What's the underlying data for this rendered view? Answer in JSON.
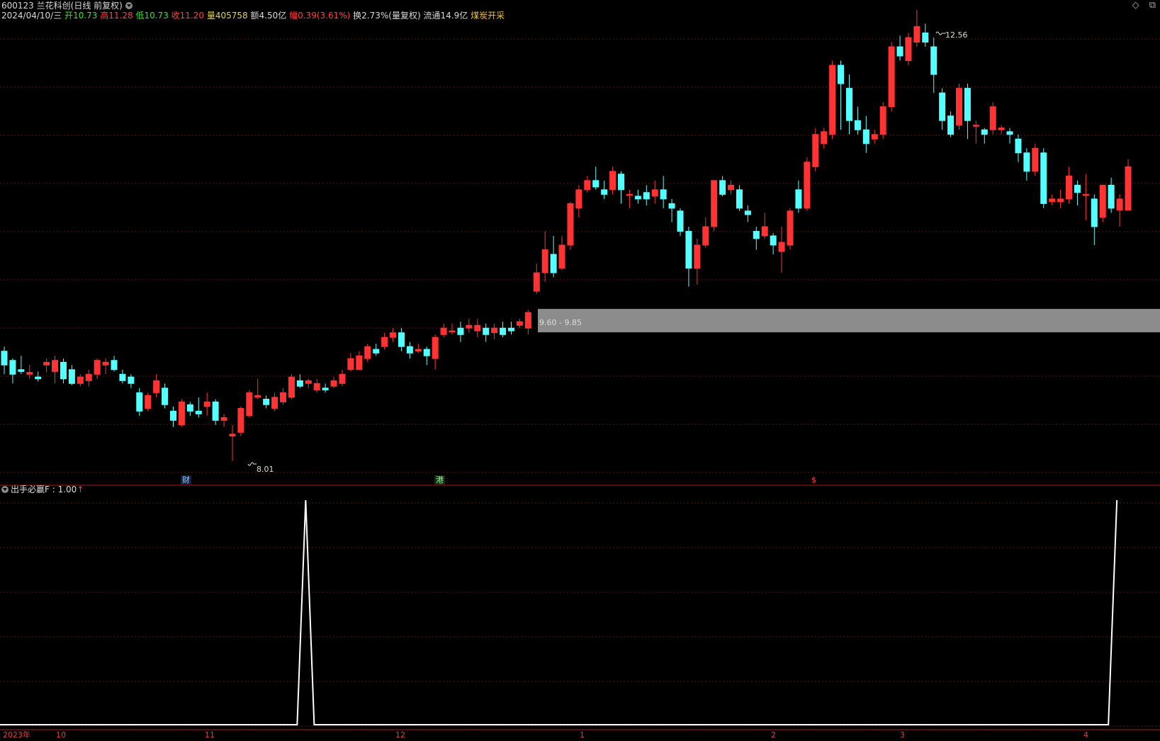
{
  "header": {
    "code": "600123",
    "name": "兰花科创",
    "mode": "(日线 前复权)",
    "date": "2024/04/10/三",
    "open_label": "开",
    "open": "10.73",
    "high_label": "高",
    "high": "11.28",
    "low_label": "低",
    "low": "10.73",
    "close_label": "收",
    "close": "11.20",
    "vol_label": "量",
    "vol": "405758",
    "amt_label": "额",
    "amt": "4.50亿",
    "chg_label": "幅",
    "chg": "0.39(3.61%)",
    "turn_label": "换",
    "turn": "2.73%(量复权)",
    "float_label": "流通",
    "float": "14.9亿",
    "concept": "煤炭开采"
  },
  "window_icons": [
    "diamond-icon",
    "restore-icon"
  ],
  "annotations": {
    "high_marker": "12.56",
    "low_marker": "8.01",
    "zone_label": "9.60 - 9.85"
  },
  "badges": {
    "cai": "财",
    "gang": "港",
    "dollar": "$"
  },
  "indicator": {
    "title": "出手必赢F",
    "value": ": 1.00",
    "arrow": "↑"
  },
  "x_labels": [
    "2023年",
    "10",
    "11",
    "12",
    "1",
    "2",
    "3",
    "4"
  ],
  "colors": {
    "up": "#ff3333",
    "down": "#54ffff",
    "grid": "#6a1010",
    "zone": "#8c8c8c",
    "line": "#ffffff"
  },
  "chart_data": {
    "type": "candlestick",
    "ylim": [
      7.9,
      12.7
    ],
    "candles": [
      [
        9.2,
        9.05,
        9.25,
        8.95
      ],
      [
        9.1,
        8.95,
        9.12,
        8.85
      ],
      [
        9.0,
        8.98,
        9.15,
        8.95
      ],
      [
        8.95,
        8.97,
        9.05,
        8.9
      ],
      [
        8.92,
        8.9,
        8.98,
        8.87
      ],
      [
        9.05,
        9.08,
        9.12,
        8.97
      ],
      [
        8.98,
        9.1,
        9.15,
        8.85
      ],
      [
        9.08,
        8.9,
        9.12,
        8.85
      ],
      [
        9.0,
        8.85,
        9.05,
        8.83
      ],
      [
        8.85,
        8.92,
        8.95,
        8.82
      ],
      [
        8.88,
        8.95,
        9.0,
        8.82
      ],
      [
        8.95,
        9.1,
        9.12,
        8.9
      ],
      [
        9.05,
        9.08,
        9.12,
        8.95
      ],
      [
        9.1,
        9.0,
        9.15,
        8.98
      ],
      [
        8.95,
        8.88,
        9.0,
        8.85
      ],
      [
        8.92,
        8.85,
        8.95,
        8.8
      ],
      [
        8.75,
        8.55,
        8.8,
        8.5
      ],
      [
        8.58,
        8.72,
        8.75,
        8.55
      ],
      [
        8.75,
        8.88,
        8.95,
        8.7
      ],
      [
        8.8,
        8.62,
        8.85,
        8.58
      ],
      [
        8.55,
        8.45,
        8.6,
        8.38
      ],
      [
        8.4,
        8.65,
        8.68,
        8.38
      ],
      [
        8.62,
        8.55,
        8.65,
        8.5
      ],
      [
        8.55,
        8.52,
        8.7,
        8.48
      ],
      [
        8.6,
        8.65,
        8.75,
        8.5
      ],
      [
        8.65,
        8.45,
        8.68,
        8.4
      ],
      [
        8.45,
        8.48,
        8.52,
        8.38
      ],
      [
        8.28,
        8.3,
        8.4,
        8.01
      ],
      [
        8.32,
        8.58,
        8.6,
        8.28
      ],
      [
        8.5,
        8.75,
        8.78,
        8.48
      ],
      [
        8.7,
        8.72,
        8.9,
        8.68
      ],
      [
        8.68,
        8.62,
        8.72,
        8.58
      ],
      [
        8.58,
        8.7,
        8.75,
        8.55
      ],
      [
        8.65,
        8.75,
        8.8,
        8.62
      ],
      [
        8.7,
        8.92,
        8.95,
        8.68
      ],
      [
        8.88,
        8.82,
        8.95,
        8.8
      ],
      [
        8.85,
        8.88,
        8.9,
        8.8
      ],
      [
        8.78,
        8.85,
        8.9,
        8.75
      ],
      [
        8.8,
        8.78,
        8.85,
        8.75
      ],
      [
        8.82,
        8.88,
        8.92,
        8.8
      ],
      [
        8.85,
        8.95,
        9.0,
        8.82
      ],
      [
        9.0,
        9.12,
        9.18,
        8.98
      ],
      [
        9.0,
        9.15,
        9.2,
        9.0
      ],
      [
        9.12,
        9.25,
        9.28,
        9.08
      ],
      [
        9.22,
        9.18,
        9.28,
        9.15
      ],
      [
        9.25,
        9.35,
        9.4,
        9.22
      ],
      [
        9.35,
        9.4,
        9.45,
        9.3
      ],
      [
        9.4,
        9.25,
        9.45,
        9.2
      ],
      [
        9.25,
        9.18,
        9.3,
        9.12
      ],
      [
        9.2,
        9.22,
        9.28,
        9.18
      ],
      [
        9.22,
        9.15,
        9.25,
        9.05
      ],
      [
        9.12,
        9.35,
        9.38,
        9.0
      ],
      [
        9.38,
        9.45,
        9.5,
        9.35
      ],
      [
        9.42,
        9.42,
        9.5,
        9.38
      ],
      [
        9.45,
        9.38,
        9.52,
        9.3
      ],
      [
        9.45,
        9.48,
        9.55,
        9.4
      ],
      [
        9.42,
        9.48,
        9.55,
        9.35
      ],
      [
        9.45,
        9.38,
        9.5,
        9.3
      ],
      [
        9.4,
        9.45,
        9.5,
        9.33
      ],
      [
        9.45,
        9.38,
        9.52,
        9.35
      ],
      [
        9.45,
        9.42,
        9.52,
        9.38
      ],
      [
        9.48,
        9.52,
        9.55,
        9.45
      ],
      [
        9.45,
        9.62,
        9.65,
        9.38
      ],
      [
        9.85,
        10.05,
        10.15,
        9.82
      ],
      [
        10.05,
        10.3,
        10.5,
        9.95
      ],
      [
        10.25,
        10.05,
        10.45,
        10.0
      ],
      [
        10.1,
        10.35,
        10.45,
        10.08
      ],
      [
        10.35,
        10.8,
        10.82,
        10.3
      ],
      [
        10.75,
        10.95,
        11.0,
        10.65
      ],
      [
        10.95,
        11.05,
        11.1,
        10.92
      ],
      [
        11.05,
        10.98,
        11.2,
        10.95
      ],
      [
        10.95,
        10.9,
        11.05,
        10.85
      ],
      [
        10.95,
        11.15,
        11.2,
        10.9
      ],
      [
        11.12,
        10.95,
        11.15,
        10.8
      ],
      [
        10.9,
        10.9,
        10.95,
        10.75
      ],
      [
        10.88,
        10.85,
        10.95,
        10.8
      ],
      [
        10.92,
        10.85,
        11.0,
        10.78
      ],
      [
        10.88,
        10.95,
        11.05,
        10.8
      ],
      [
        10.95,
        10.85,
        11.1,
        10.75
      ],
      [
        10.8,
        10.75,
        10.85,
        10.6
      ],
      [
        10.72,
        10.5,
        10.75,
        10.45
      ],
      [
        10.5,
        10.1,
        10.55,
        9.9
      ],
      [
        10.1,
        10.35,
        10.42,
        9.92
      ],
      [
        10.35,
        10.55,
        10.65,
        10.32
      ],
      [
        10.55,
        11.05,
        11.05,
        10.5
      ],
      [
        11.05,
        10.9,
        11.1,
        10.88
      ],
      [
        10.95,
        11.0,
        11.05,
        10.9
      ],
      [
        10.95,
        10.75,
        11.0,
        10.72
      ],
      [
        10.72,
        10.68,
        10.78,
        10.6
      ],
      [
        10.5,
        10.42,
        10.55,
        10.3
      ],
      [
        10.45,
        10.55,
        10.7,
        10.42
      ],
      [
        10.45,
        10.35,
        10.48,
        10.25
      ],
      [
        10.28,
        10.38,
        10.55,
        10.05
      ],
      [
        10.35,
        10.72,
        10.75,
        10.3
      ],
      [
        10.95,
        10.75,
        11.05,
        10.7
      ],
      [
        10.75,
        11.25,
        11.3,
        10.72
      ],
      [
        11.2,
        11.55,
        11.62,
        11.15
      ],
      [
        11.45,
        11.58,
        11.62,
        11.4
      ],
      [
        11.55,
        12.3,
        12.35,
        11.5
      ],
      [
        12.3,
        12.1,
        12.35,
        11.6
      ],
      [
        12.05,
        11.7,
        12.2,
        11.55
      ],
      [
        11.7,
        11.6,
        11.85,
        11.55
      ],
      [
        11.6,
        11.45,
        11.75,
        11.35
      ],
      [
        11.5,
        11.55,
        11.6,
        11.45
      ],
      [
        11.55,
        11.85,
        11.9,
        11.5
      ],
      [
        11.85,
        12.5,
        12.55,
        11.8
      ],
      [
        12.5,
        12.4,
        12.62,
        12.35
      ],
      [
        12.35,
        12.6,
        12.65,
        12.3
      ],
      [
        12.55,
        12.72,
        12.9,
        12.5
      ],
      [
        12.65,
        12.55,
        12.75,
        12.5
      ],
      [
        12.5,
        12.2,
        12.6,
        12.0
      ],
      [
        12.0,
        11.7,
        12.05,
        11.6
      ],
      [
        11.75,
        11.55,
        11.8,
        11.52
      ],
      [
        11.65,
        12.05,
        12.1,
        11.6
      ],
      [
        12.05,
        11.7,
        12.1,
        11.5
      ],
      [
        11.65,
        11.65,
        11.7,
        11.45
      ],
      [
        11.6,
        11.55,
        11.62,
        11.45
      ],
      [
        11.6,
        11.85,
        11.9,
        11.55
      ],
      [
        11.6,
        11.62,
        11.65,
        11.55
      ],
      [
        11.58,
        11.55,
        11.62,
        11.45
      ],
      [
        11.5,
        11.35,
        11.55,
        11.25
      ],
      [
        11.35,
        11.15,
        11.4,
        11.05
      ],
      [
        11.15,
        11.4,
        11.45,
        11.1
      ],
      [
        11.35,
        10.8,
        11.4,
        10.75
      ],
      [
        10.82,
        10.85,
        10.9,
        10.78
      ],
      [
        10.82,
        10.85,
        10.95,
        10.75
      ],
      [
        10.85,
        11.1,
        11.2,
        10.8
      ],
      [
        11.0,
        10.92,
        11.05,
        10.78
      ],
      [
        10.9,
        10.9,
        11.12,
        10.62
      ],
      [
        10.85,
        10.55,
        10.9,
        10.35
      ],
      [
        10.65,
        11.0,
        11.0,
        10.6
      ],
      [
        11.0,
        10.75,
        11.08,
        10.7
      ],
      [
        10.73,
        10.85,
        10.9,
        10.55
      ],
      [
        10.73,
        11.2,
        11.28,
        10.73
      ]
    ],
    "zone": [
      9.6,
      9.85
    ],
    "indicator_series_peaks": [
      {
        "candle_index": 35,
        "value": 1.0
      },
      {
        "candle_index": 131,
        "value": 1.0
      }
    ],
    "indicator_ylim": [
      0,
      1
    ]
  }
}
